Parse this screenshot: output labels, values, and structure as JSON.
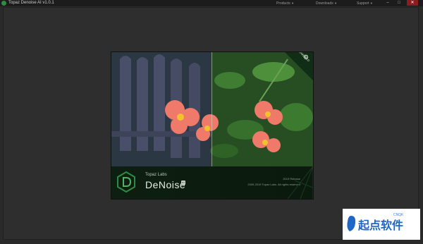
{
  "window": {
    "title": "Topaz Denoise AI v1.0.1",
    "menu": [
      "Products",
      "Downloads",
      "Support"
    ],
    "controls": [
      "minimize",
      "maximize",
      "close"
    ]
  },
  "splash": {
    "badge": "AI POWERED",
    "brand_small": "Topaz Labs",
    "brand_name": "DeNoise",
    "brand_tag": "AI",
    "release": "2019 Release",
    "copyright": "2009-2019 Topaz Labs. All rights reserved"
  },
  "watermark": {
    "text": "起点软件",
    "sub": "CNQK"
  },
  "colors": {
    "accent": "#2f8a44",
    "frame_bg": "#2e2e2e",
    "splash_footer": "#0d1f11",
    "watermark_blue": "#1f66c9"
  }
}
